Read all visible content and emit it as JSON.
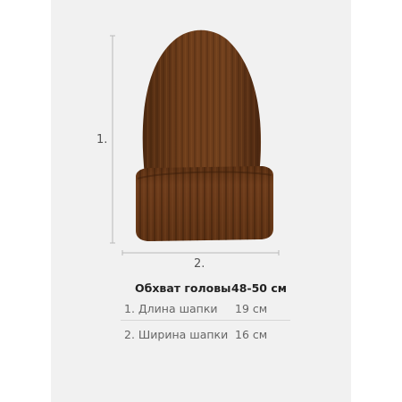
{
  "dimension_labels": {
    "height": "1.",
    "width": "2."
  },
  "colors": {
    "hat": "#6b3b1a",
    "background_panel": "#f1f1f1",
    "guide_line": "#b9b9b9"
  },
  "size_table": {
    "header": {
      "label": "Обхват головы",
      "value": "48-50 см"
    },
    "rows": [
      {
        "label": "1. Длина шапки",
        "value": "19 см"
      },
      {
        "label": "2. Ширина шапки",
        "value": "16 см"
      }
    ]
  },
  "icons": {
    "hat": "knit-beanie-image"
  }
}
